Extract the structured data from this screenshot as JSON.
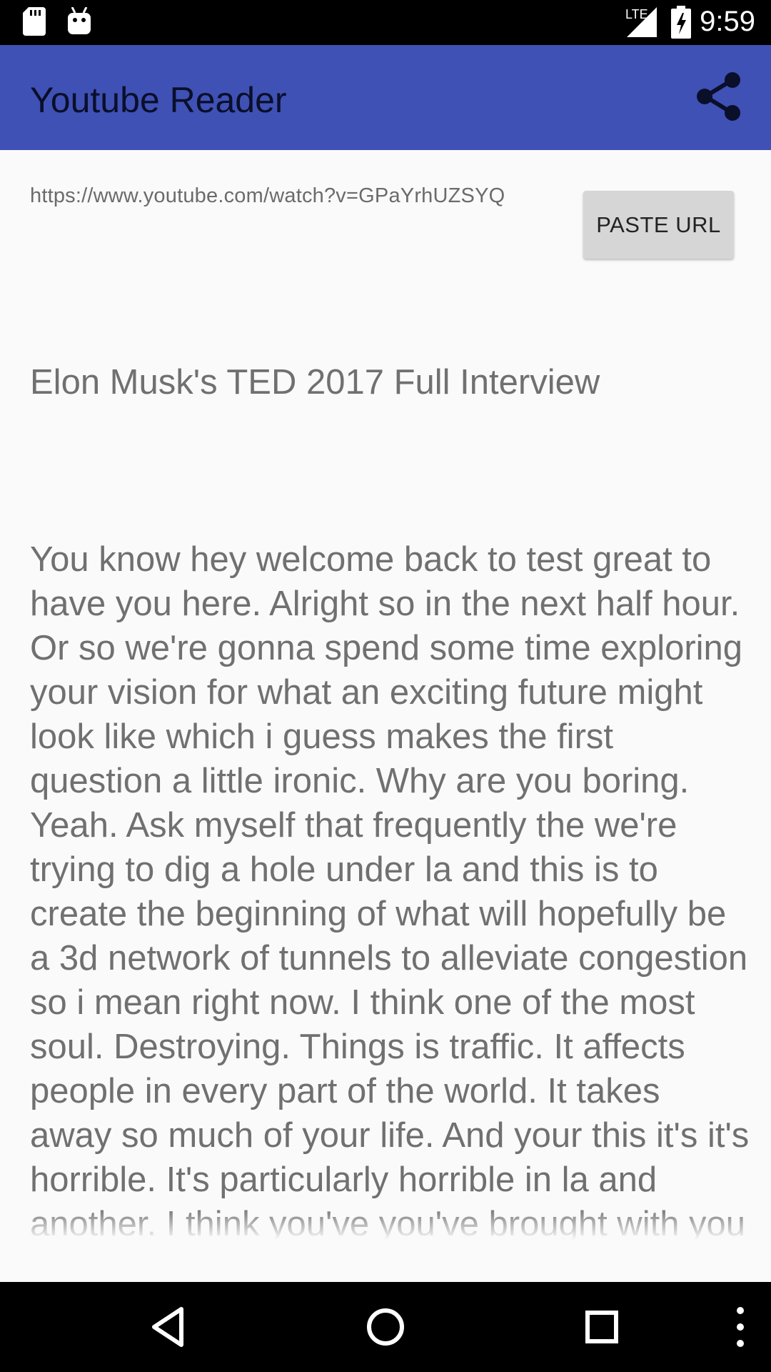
{
  "status_bar": {
    "time": "9:59",
    "network": "LTE",
    "icons": [
      "sd-card-icon",
      "android-debug-icon",
      "lte-signal-icon",
      "battery-charging-icon"
    ]
  },
  "app_bar": {
    "title": "Youtube Reader",
    "share_icon": "share-icon",
    "color": "#3f51b5"
  },
  "url_row": {
    "url": "https://www.youtube.com/watch?v=GPaYrhUZSYQ",
    "paste_label": "PASTE URL"
  },
  "transcript": {
    "title": "Elon Musk's TED 2017 Full Interview",
    "body": "You know hey welcome back to test great to have you here. Alright so in the next half hour. Or so we're gonna spend some time exploring your vision for what an exciting future might look like which i guess makes the first question a little ironic. Why are you boring. Yeah. Ask myself that frequently the we're trying to dig a hole under la and this is to create the beginning of what will hopefully be a 3d network of tunnels to alleviate congestion so i mean right now. I think one of the most soul. Destroying. Things is traffic. It affects people in every part of the world. It takes away so much of your life. And your this it's it's horrible. It's particularly horrible in la and another. I think you've you've brought with you the first visualization that's been shown of this coming again. I show this yeah absolutely so this is"
  },
  "nav_bar": {
    "buttons": [
      "back-icon",
      "home-icon",
      "recents-icon",
      "more-icon"
    ]
  }
}
